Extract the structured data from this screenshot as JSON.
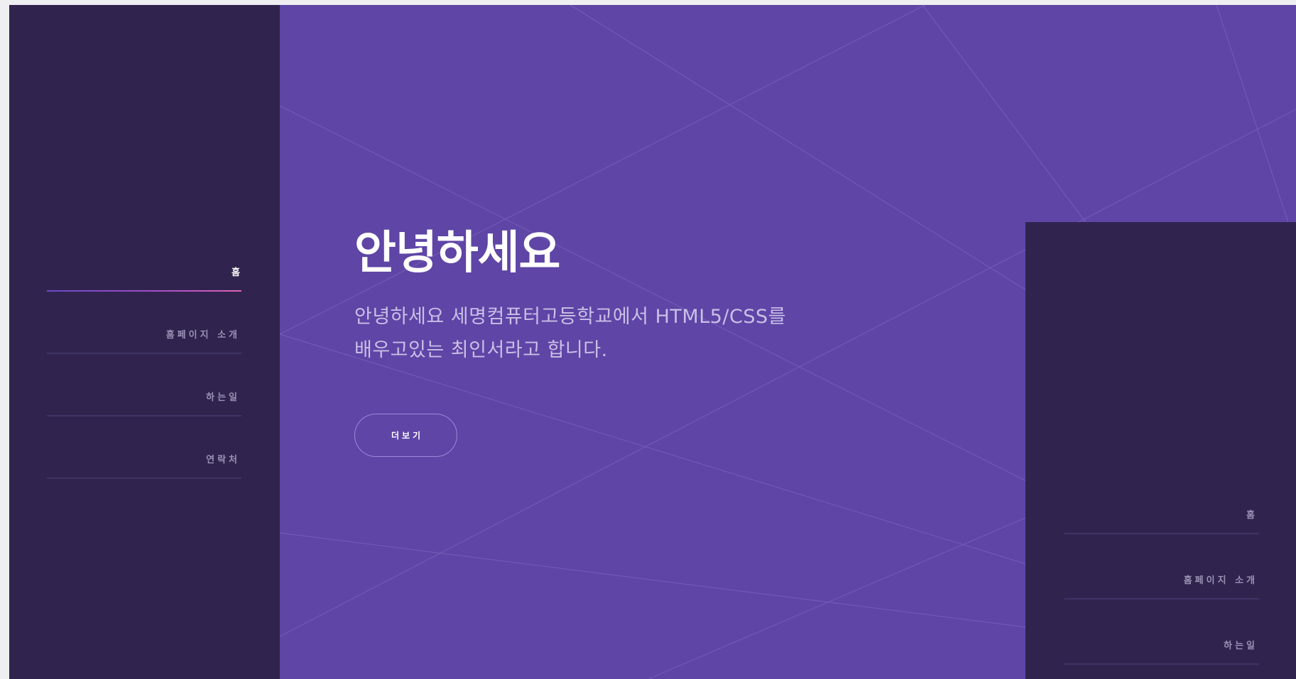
{
  "colors": {
    "page_background": "#efeef0",
    "hero_background": "#5e45a6",
    "sidebar_background": "#30244f",
    "active_underline_gradient": [
      "#6a48c8",
      "#e261b6"
    ],
    "nav_text": "#9b91b3",
    "nav_text_active": "#ffffff",
    "hero_text": "#c9bfe6"
  },
  "sidebar_left": {
    "nav": [
      {
        "label": "홈",
        "active": true
      },
      {
        "label": "홈페이지 소개",
        "active": false
      },
      {
        "label": "하는일",
        "active": false
      },
      {
        "label": "연락처",
        "active": false
      }
    ]
  },
  "hero": {
    "title": "안녕하세요",
    "text": "안녕하세요 세명컴퓨터고등학교에서 HTML5/CSS를 배우고있는 최인서라고 합니다.",
    "button_label": "더보기"
  },
  "sidebar_right": {
    "nav": [
      {
        "label": "홈",
        "active": false
      },
      {
        "label": "홈페이지 소개",
        "active": false
      },
      {
        "label": "하는일",
        "active": false
      }
    ]
  }
}
